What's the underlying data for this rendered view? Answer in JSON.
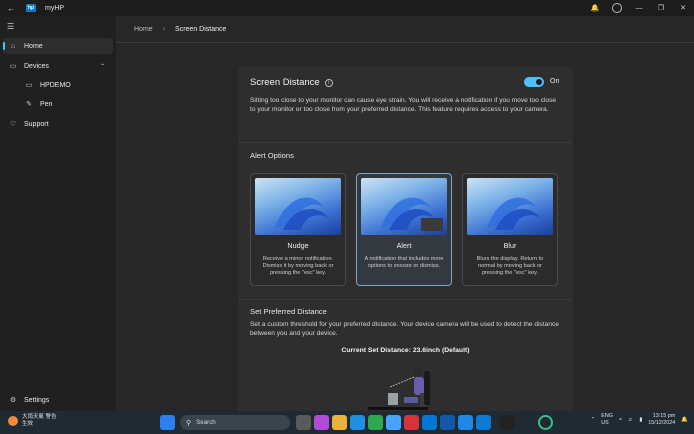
{
  "window": {
    "title": "myHP"
  },
  "sidebar": {
    "items": [
      {
        "label": "Home",
        "icon": "home-icon"
      },
      {
        "label": "Devices",
        "icon": "devices-icon"
      },
      {
        "label": "HPDEMO",
        "icon": "laptop-icon"
      },
      {
        "label": "Pen",
        "icon": "pen-icon"
      },
      {
        "label": "Support",
        "icon": "support-icon"
      }
    ],
    "settings_label": "Settings"
  },
  "breadcrumb": {
    "home": "Home",
    "current": "Screen Distance"
  },
  "screen_distance": {
    "title": "Screen Distance",
    "toggle_state": "On",
    "description": "Sitting too close to your monitor can cause eye strain. You will receive a notification if you move too close to your monitor or too close from your preferred distance. This feature requires access to your camera.",
    "alert_options_title": "Alert Options",
    "options": [
      {
        "title": "Nudge",
        "desc": "Receive a minor notification. Dismiss it by moving back or pressing the \"esc\" key."
      },
      {
        "title": "Alert",
        "desc": "A notification that includes more options to snooze or dismiss."
      },
      {
        "title": "Blur",
        "desc": "Blurs the display. Return to normal by moving back or pressing the \"esc\" key."
      }
    ],
    "preferred_title": "Set Preferred Distance",
    "preferred_desc": "Set a custom threshold for your preferred distance. Your device camera will be used to detect the distance between you and your device.",
    "current_distance": "Current Set Distance: 23.6inch (Default)"
  },
  "taskbar": {
    "weather_line1": "大雨天氣 警告",
    "weather_line2": "生效",
    "search_placeholder": "Search",
    "lang_line1": "ENG",
    "lang_line2": "US",
    "time": "13:15 pm",
    "date": "15/12/2024"
  },
  "colors": {
    "accent": "#4cc2ff",
    "background": "#202020",
    "card": "#2e2e2e"
  }
}
